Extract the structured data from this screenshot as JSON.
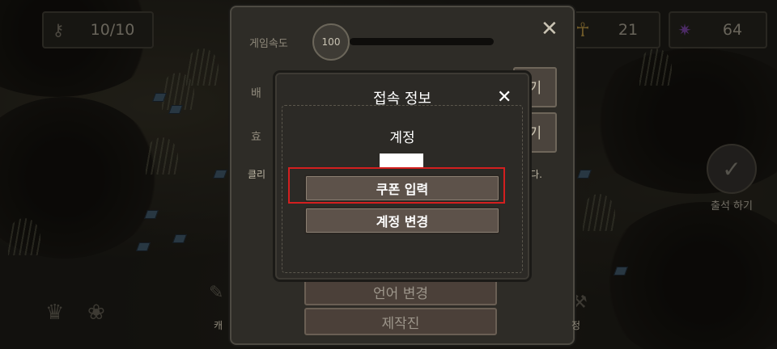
{
  "hud": {
    "keys": {
      "icon": "key-icon",
      "value": "10/10"
    },
    "ankh": {
      "icon": "ankh-icon",
      "value": "21"
    },
    "gem": {
      "icon": "purple-gem-icon",
      "value": "64",
      "color": "#8a4fb8"
    }
  },
  "side": {
    "attendance_label": "출석 하기",
    "icon": "attendance-badge-icon"
  },
  "settings": {
    "game_speed_label": "게임속도",
    "game_speed_value": "100",
    "row1_label": "배",
    "row1_button": "기",
    "row2_label": "효",
    "row2_button": "기",
    "note_left": "클리",
    "note_right": "니다.",
    "language_button": "언어 변경",
    "credits_button": "제작진",
    "bottom_left_label": "캐",
    "bottom_right_label": "정"
  },
  "modal": {
    "title": "접속 정보",
    "account_label": "계정",
    "coupon_button": "쿠폰 입력",
    "change_account_button": "계정 변경",
    "highlight_color": "#d41f1f"
  }
}
